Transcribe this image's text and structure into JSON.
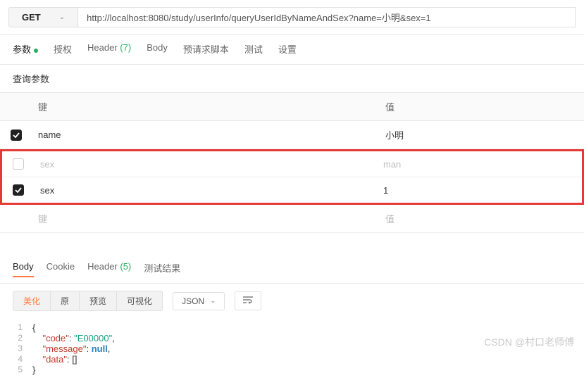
{
  "request": {
    "method": "GET",
    "url": "http://localhost:8080/study/userInfo/queryUserIdByNameAndSex?name=小明&sex=1"
  },
  "tabs": {
    "params": {
      "label": "参数",
      "active": true
    },
    "auth": {
      "label": "授权"
    },
    "header": {
      "label": "Header",
      "count": "(7)"
    },
    "body": {
      "label": "Body"
    },
    "prereq": {
      "label": "预请求脚本"
    },
    "test": {
      "label": "测试"
    },
    "settings": {
      "label": "设置"
    }
  },
  "section_label": "查询参数",
  "table": {
    "header_key": "键",
    "header_value": "值",
    "rows": [
      {
        "checked": true,
        "key": "name",
        "value": "小明",
        "disabled": false
      },
      {
        "checked": false,
        "key": "sex",
        "value": "man",
        "disabled": true
      },
      {
        "checked": true,
        "key": "sex",
        "value": "1",
        "disabled": false
      }
    ],
    "placeholder_key": "键",
    "placeholder_value": "值"
  },
  "response": {
    "tabs": {
      "body": {
        "label": "Body",
        "active": true
      },
      "cookie": {
        "label": "Cookie"
      },
      "header": {
        "label": "Header",
        "count": "(5)"
      },
      "results": {
        "label": "测试结果"
      }
    },
    "buttons": {
      "beautify": "美化",
      "raw": "原",
      "preview": "预览",
      "visualize": "可视化"
    },
    "format": "JSON",
    "json": {
      "code": "E00000",
      "message_key": "message",
      "data_key": "data"
    }
  },
  "watermark": "CSDN @村口老师傅"
}
